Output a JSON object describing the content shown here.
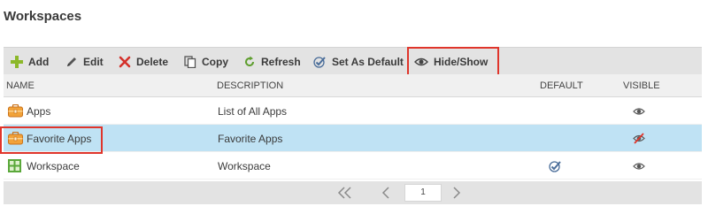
{
  "page": {
    "title": "Workspaces"
  },
  "toolbar": {
    "add_label": "Add",
    "edit_label": "Edit",
    "delete_label": "Delete",
    "copy_label": "Copy",
    "refresh_label": "Refresh",
    "set_default_label": "Set As Default",
    "hide_show_label": "Hide/Show"
  },
  "table": {
    "columns": [
      "NAME",
      "DESCRIPTION",
      "DEFAULT",
      "VISIBLE"
    ],
    "rows": [
      {
        "name": "Apps",
        "description": "List of All Apps",
        "icon": "briefcase-icon",
        "default": false,
        "visible": true
      },
      {
        "name": "Favorite Apps",
        "description": "Favorite Apps",
        "icon": "briefcase-icon",
        "default": false,
        "visible": false
      },
      {
        "name": "Workspace",
        "description": "Workspace",
        "icon": "grid-icon",
        "default": true,
        "visible": true
      }
    ]
  },
  "pager": {
    "page": "1"
  },
  "colors": {
    "accent": "#e0352b",
    "selected_row": "#bfe2f4",
    "toolbar_bg": "#e3e3e3"
  }
}
